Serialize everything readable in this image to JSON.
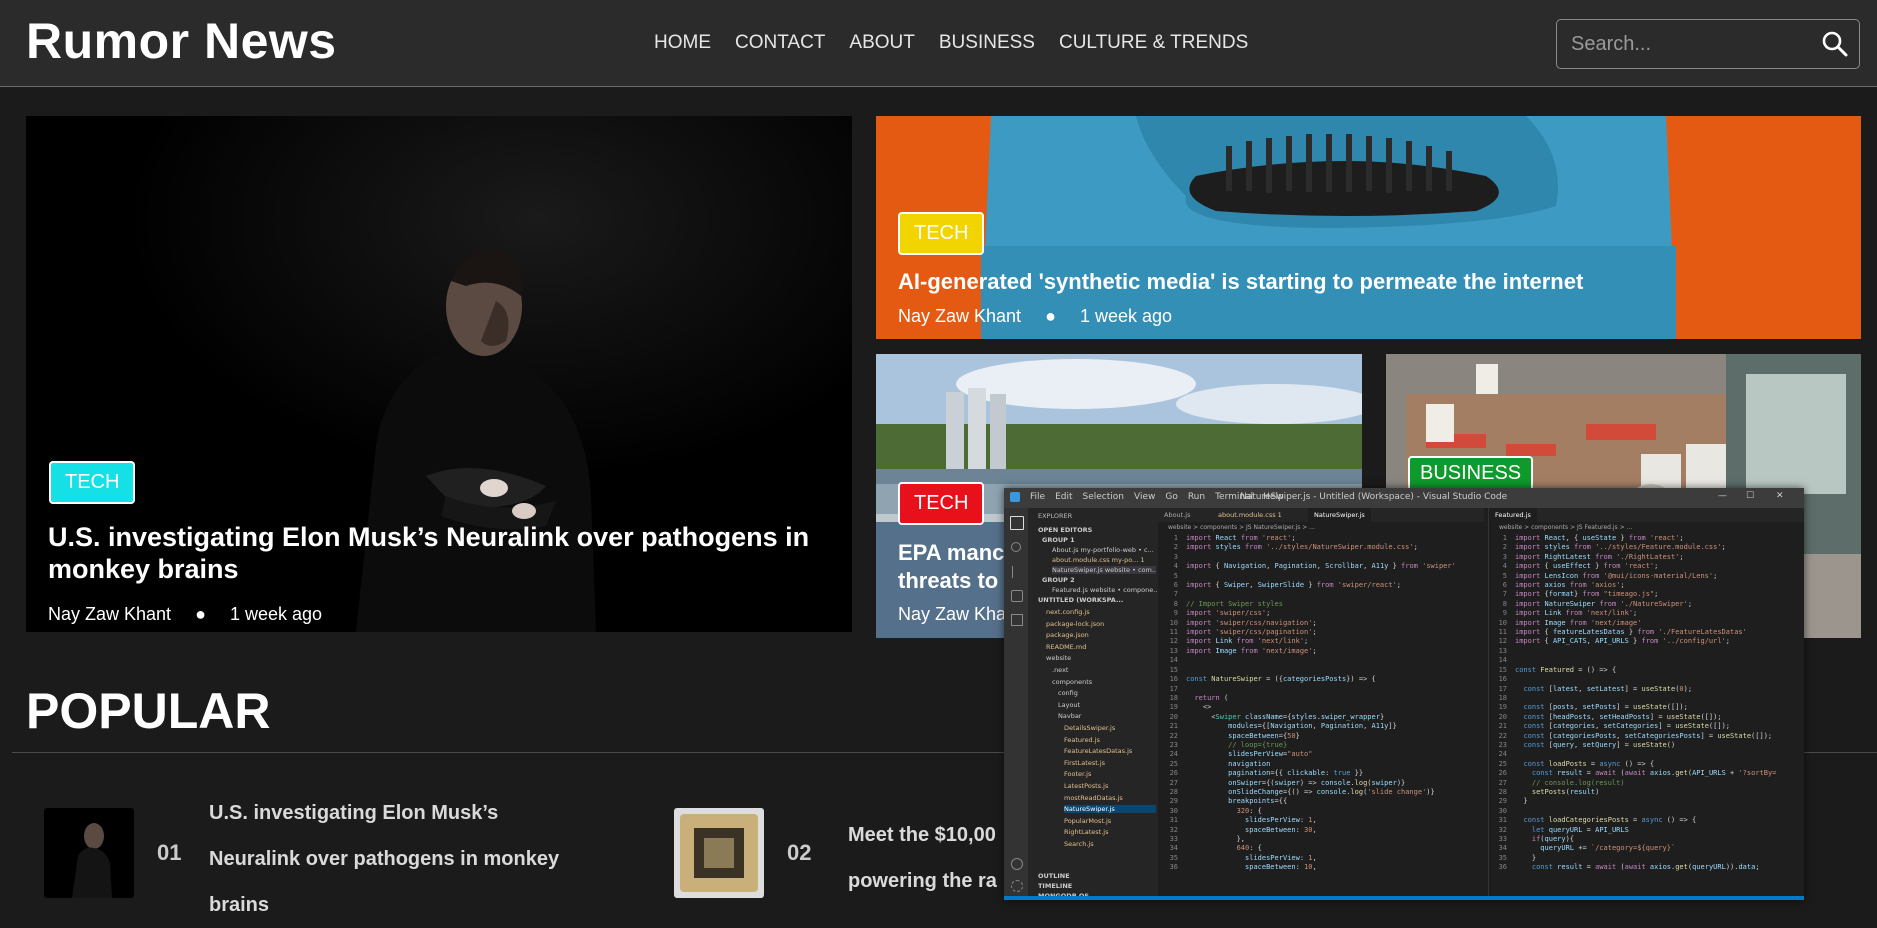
{
  "header": {
    "brand": "Rumor News",
    "nav": [
      "HOME",
      "CONTACT",
      "ABOUT",
      "BUSINESS",
      "CULTURE & TRENDS"
    ],
    "search_placeholder": "Search..."
  },
  "featured": {
    "main": {
      "category": "TECH",
      "title": "U.S. investigating Elon Musk’s Neuralink over pathogens in monkey brains",
      "author": "Nay Zaw Khant",
      "time": "1 week ago"
    },
    "top_right": {
      "category": "TECH",
      "title": "AI-generated 'synthetic media' is starting to permeate the internet",
      "author": "Nay Zaw Khant",
      "time": "1 week ago"
    },
    "bottom_left": {
      "category": "TECH",
      "title_line1": "EPA manc",
      "title_line2": "threats to",
      "author": "Nay Zaw Kha"
    },
    "bottom_right": {
      "category": "BUSINESS"
    }
  },
  "popular": {
    "heading": "POPULAR",
    "items": [
      {
        "num": "01",
        "title_lines": [
          "U.S. investigating Elon Musk’s",
          "Neuralink over pathogens in monkey",
          "brains"
        ]
      },
      {
        "num": "02",
        "title_lines": [
          "Meet the $10,00",
          "powering the ra"
        ]
      }
    ]
  },
  "vscode": {
    "menu": [
      "File",
      "Edit",
      "Selection",
      "View",
      "Go",
      "Run",
      "Terminal",
      "Help"
    ],
    "window_title": "NatureSwiper.js - Untitled (Workspace) - Visual Studio Code",
    "explorer_label": "EXPLORER",
    "open_editors": "OPEN EDITORS",
    "group1": "GROUP 1",
    "group1_files": [
      "About.js  my-portfolio-web • c...",
      "about.module.css  my-po...  1",
      "NatureSwiper.js  website • com..."
    ],
    "group2": "GROUP 2",
    "group2_files": [
      "Featured.js  website • compone..."
    ],
    "workspace": "UNTITLED (WORKSPA...",
    "tree": [
      "next.config.js",
      "package-lock.json",
      "package.json",
      "README.md",
      "website",
      ".next",
      "components",
      "config",
      "Layout",
      "Navbar",
      "DetailsSwiper.js",
      "Featured.js",
      "FeatureLatesDatas.js",
      "FirstLatest.js",
      "Footer.js",
      "LatestPosts.js",
      "mostReadDatas.js",
      "NatureSwiper.js",
      "PopularMost.js",
      "RightLatest.js",
      "Search.js"
    ],
    "outline": "OUTLINE",
    "timeline": "TIMELINE",
    "mongodb": "MONGODB OS",
    "tabs_left": [
      "About.js",
      "about.module.css 1",
      "NatureSwiper.js"
    ],
    "tabs_right": [
      "Featured.js"
    ],
    "breadcrumb_left": "website > components > JS NatureSwiper.js > ...",
    "breadcrumb_right": "website > components > JS Featured.js > ..."
  }
}
